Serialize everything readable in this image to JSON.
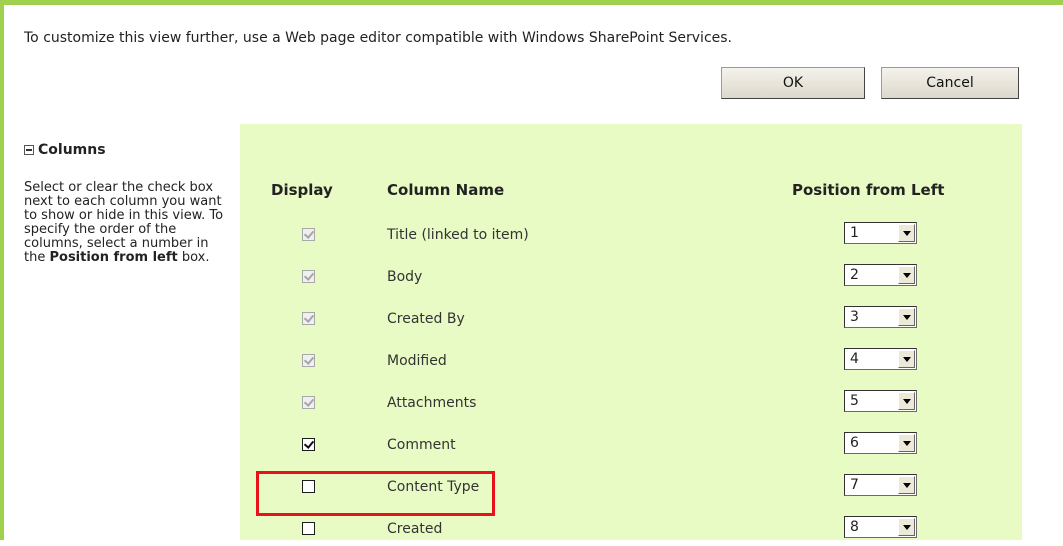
{
  "intro_text": "To customize this view further, use a Web page editor compatible with Windows SharePoint Services.",
  "buttons": {
    "ok_label": "OK",
    "cancel_label": "Cancel"
  },
  "section": {
    "title": "Columns",
    "desc_part1": "Select or clear the check box next to each column you want to show or hide in this view. To specify the order of the columns, select a number in the",
    "desc_bold": "Position from left",
    "desc_part2": "box."
  },
  "headers": {
    "display": "Display",
    "column_name": "Column Name",
    "position": "Position from Left"
  },
  "rows": [
    {
      "label": "Title (linked to item)",
      "checked": true,
      "disabled": true,
      "position": "1"
    },
    {
      "label": "Body",
      "checked": true,
      "disabled": true,
      "position": "2"
    },
    {
      "label": "Created By",
      "checked": true,
      "disabled": true,
      "position": "3"
    },
    {
      "label": "Modified",
      "checked": true,
      "disabled": true,
      "position": "4"
    },
    {
      "label": "Attachments",
      "checked": true,
      "disabled": true,
      "position": "5"
    },
    {
      "label": "Comment",
      "checked": true,
      "disabled": false,
      "position": "6"
    },
    {
      "label": "Content Type",
      "checked": false,
      "disabled": false,
      "position": "7"
    },
    {
      "label": "Created",
      "checked": false,
      "disabled": false,
      "position": "8"
    }
  ],
  "colors": {
    "panel": "#e8fbc4",
    "border": "#9fd14f",
    "highlight": "#e8121b"
  }
}
